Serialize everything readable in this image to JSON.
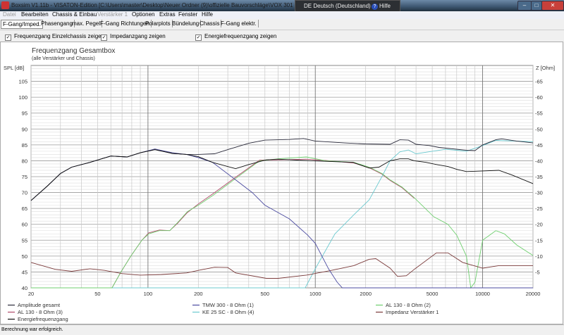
{
  "window": {
    "title": "Boxsim V1.11b - VISATON-Edition [C:\\Users\\master\\Desktop\\Neuer Ordner (9)\\offizielle Bauvorschläge\\VOX 301\\VOX 301",
    "language": "DE Deutsch (Deutschland)",
    "help": "Hilfe",
    "minimize": "–",
    "maximize": "□",
    "close": "✕"
  },
  "menu": [
    "Datei",
    "Bearbeiten",
    "Chassis & Einbau",
    "Verstärker 1",
    "Optionen",
    "Extras",
    "Fenster",
    "Hilfe"
  ],
  "tabs": [
    "F-Gang/Imped.",
    "Phasengang",
    "max. Pegel",
    "F-Gang Richtungen",
    "Polarplots",
    "Bündelung",
    "Chassis",
    "F-Gang elektr."
  ],
  "checkboxes": [
    {
      "label": "Frequenzgang Einzelchassis zeigen",
      "checked": true
    },
    {
      "label": "Impedanzgang zeigen",
      "checked": true
    },
    {
      "label": "Energiefrequenzgang zeigen",
      "checked": true
    }
  ],
  "checkmark": "✓",
  "status": "Berechnung war erfolgreich.",
  "chart_data": {
    "type": "line",
    "title": "Frequenzgang Gesamtbox",
    "subtitle": "(alle Verstärker und Chassis)",
    "ylabel": "SPL [dB]",
    "y2label": "Z [Ohm]",
    "xscale": "log",
    "xlim": [
      20,
      20000
    ],
    "ylim": [
      40,
      110
    ],
    "y2lim": [
      0,
      70
    ],
    "xticks": [
      "20",
      "50",
      "100",
      "200",
      "500",
      "1000",
      "2000",
      "5000",
      "10000",
      "20000"
    ],
    "yticks": [
      "40",
      "45",
      "50",
      "55",
      "60",
      "65",
      "70",
      "75",
      "80",
      "85",
      "90",
      "95",
      "100",
      "105"
    ],
    "y2ticks": [
      "5",
      "10",
      "15",
      "20",
      "25",
      "30",
      "35",
      "40",
      "45",
      "50",
      "55",
      "60",
      "65"
    ],
    "grid": true,
    "legend_position": "bottom",
    "series": [
      {
        "name": "Amplitude gesamt",
        "color": "#2a2a3a",
        "points": [
          [
            20,
            67.5
          ],
          [
            25,
            72
          ],
          [
            30,
            76
          ],
          [
            35,
            78
          ],
          [
            45,
            79.5
          ],
          [
            60,
            81.5
          ],
          [
            75,
            81.2
          ],
          [
            90,
            82.5
          ],
          [
            110,
            83.5
          ],
          [
            140,
            82.3
          ],
          [
            170,
            82
          ],
          [
            200,
            82
          ],
          [
            250,
            82.2
          ],
          [
            300,
            83.5
          ],
          [
            400,
            85.5
          ],
          [
            500,
            86.5
          ],
          [
            700,
            86.7
          ],
          [
            850,
            87
          ],
          [
            1000,
            86.2
          ],
          [
            1500,
            85.6
          ],
          [
            2000,
            85.3
          ],
          [
            2800,
            85.2
          ],
          [
            3200,
            86.6
          ],
          [
            3600,
            86.5
          ],
          [
            4000,
            85.2
          ],
          [
            4800,
            84.8
          ],
          [
            5500,
            84.2
          ],
          [
            6500,
            83.8
          ],
          [
            8000,
            83.3
          ],
          [
            9000,
            83.2
          ],
          [
            10000,
            85
          ],
          [
            12000,
            86.6
          ],
          [
            13000,
            86.9
          ],
          [
            16000,
            86.2
          ],
          [
            20000,
            85.6
          ]
        ]
      },
      {
        "name": "TMW 300 - 8 Ohm (1)",
        "color": "#4b4ba0",
        "points": [
          [
            20,
            67.5
          ],
          [
            25,
            72
          ],
          [
            30,
            76
          ],
          [
            35,
            78
          ],
          [
            45,
            79.5
          ],
          [
            60,
            81.5
          ],
          [
            75,
            81.2
          ],
          [
            90,
            82.5
          ],
          [
            110,
            83.7
          ],
          [
            140,
            82.5
          ],
          [
            170,
            82
          ],
          [
            200,
            81
          ],
          [
            243,
            79.5
          ],
          [
            334,
            74
          ],
          [
            420,
            70
          ],
          [
            500,
            66
          ],
          [
            700,
            61.7
          ],
          [
            900,
            56.6
          ],
          [
            1000,
            54
          ],
          [
            1200,
            46
          ],
          [
            1350,
            41.8
          ],
          [
            1450,
            40
          ],
          [
            20000,
            40
          ]
        ]
      },
      {
        "name": "AL 130 - 8 Ohm (2)",
        "color": "#6fcf6f",
        "points": [
          [
            20,
            40
          ],
          [
            61,
            40
          ],
          [
            69,
            45
          ],
          [
            79,
            50
          ],
          [
            92,
            55
          ],
          [
            101,
            57
          ],
          [
            117,
            58
          ],
          [
            135,
            58
          ],
          [
            150,
            60.5
          ],
          [
            172,
            64
          ],
          [
            200,
            66
          ],
          [
            243,
            69
          ],
          [
            334,
            74.4
          ],
          [
            465,
            80
          ],
          [
            600,
            80.6
          ],
          [
            885,
            81.2
          ],
          [
            1150,
            80
          ],
          [
            1700,
            79.5
          ],
          [
            2100,
            78
          ],
          [
            2500,
            76
          ],
          [
            2800,
            74
          ],
          [
            3300,
            71.7
          ],
          [
            3900,
            68.4
          ],
          [
            5100,
            62.4
          ],
          [
            6200,
            60
          ],
          [
            7000,
            56.6
          ],
          [
            8000,
            50
          ],
          [
            8500,
            40
          ],
          [
            9000,
            41.8
          ],
          [
            10000,
            55
          ],
          [
            12000,
            58
          ],
          [
            13500,
            57
          ],
          [
            16000,
            53.5
          ],
          [
            20000,
            50.2
          ]
        ]
      },
      {
        "name": "AL 130 - 8 Ohm (3)",
        "color": "#b04a6a",
        "points": [
          [
            20,
            40
          ],
          [
            61,
            40
          ],
          [
            69,
            45
          ],
          [
            79,
            50
          ],
          [
            92,
            55
          ],
          [
            101,
            57.3
          ],
          [
            117,
            58.2
          ],
          [
            135,
            58
          ],
          [
            150,
            60.3
          ],
          [
            172,
            63.7
          ],
          [
            200,
            66.4
          ],
          [
            243,
            69.5
          ],
          [
            334,
            74.8
          ],
          [
            465,
            80.2
          ],
          [
            600,
            80.3
          ],
          [
            885,
            80.5
          ],
          [
            1150,
            80.1
          ],
          [
            1700,
            79.3
          ],
          [
            2100,
            77.8
          ],
          [
            2500,
            75.8
          ],
          [
            2800,
            73.8
          ],
          [
            3300,
            71.5
          ],
          [
            3900,
            68.2
          ]
        ]
      },
      {
        "name": "KE 25 SC - 8 Ohm    (4)",
        "color": "#6cc9cf",
        "points": [
          [
            20,
            40
          ],
          [
            870,
            40
          ],
          [
            1000,
            46
          ],
          [
            1310,
            57
          ],
          [
            1700,
            63
          ],
          [
            2100,
            67.7
          ],
          [
            2500,
            75
          ],
          [
            2800,
            80
          ],
          [
            3200,
            82.8
          ],
          [
            3600,
            83.4
          ],
          [
            4000,
            82.2
          ],
          [
            5000,
            83
          ],
          [
            6000,
            83.6
          ],
          [
            7000,
            83.3
          ],
          [
            8000,
            83
          ],
          [
            10000,
            84.8
          ],
          [
            12000,
            86.4
          ],
          [
            16000,
            86.2
          ],
          [
            20000,
            86
          ]
        ]
      },
      {
        "name": "Impedanz Verstärker 1",
        "color": "#7a3a3a",
        "points": [
          [
            20,
            48
          ],
          [
            28,
            45.8
          ],
          [
            35,
            45.2
          ],
          [
            45,
            46
          ],
          [
            55,
            45.5
          ],
          [
            70,
            44.5
          ],
          [
            90,
            44
          ],
          [
            120,
            44.2
          ],
          [
            170,
            44.7
          ],
          [
            200,
            45.5
          ],
          [
            250,
            46.5
          ],
          [
            300,
            46.4
          ],
          [
            334,
            44.7
          ],
          [
            510,
            43
          ],
          [
            600,
            43
          ],
          [
            885,
            44
          ],
          [
            1250,
            45.5
          ],
          [
            1700,
            47
          ],
          [
            2100,
            49
          ],
          [
            2300,
            49.2
          ],
          [
            2800,
            46.2
          ],
          [
            3100,
            43.6
          ],
          [
            3500,
            43.8
          ],
          [
            3900,
            45.8
          ],
          [
            5300,
            51
          ],
          [
            6200,
            51
          ],
          [
            7600,
            48
          ],
          [
            10000,
            46.2
          ],
          [
            12500,
            47
          ],
          [
            20000,
            47
          ]
        ]
      },
      {
        "name": "Energiefrequenzgang",
        "color": "#111111",
        "points": [
          [
            20,
            67.5
          ],
          [
            25,
            72
          ],
          [
            30,
            76
          ],
          [
            35,
            78
          ],
          [
            45,
            79.5
          ],
          [
            60,
            81.5
          ],
          [
            75,
            81.2
          ],
          [
            90,
            82.5
          ],
          [
            110,
            83.5
          ],
          [
            140,
            82.3
          ],
          [
            170,
            82
          ],
          [
            200,
            81.3
          ],
          [
            243,
            79.5
          ],
          [
            334,
            77.5
          ],
          [
            400,
            78.8
          ],
          [
            510,
            80.3
          ],
          [
            600,
            80.5
          ],
          [
            945,
            80
          ],
          [
            1680,
            79.5
          ],
          [
            2100,
            77.7
          ],
          [
            2400,
            78
          ],
          [
            2800,
            80
          ],
          [
            3200,
            80.6
          ],
          [
            3600,
            80.6
          ],
          [
            3900,
            80
          ],
          [
            4600,
            79.5
          ],
          [
            5300,
            78.8
          ],
          [
            6200,
            78.2
          ],
          [
            7000,
            77.3
          ],
          [
            8000,
            76.6
          ],
          [
            10000,
            76.8
          ],
          [
            12500,
            77
          ],
          [
            15000,
            75.5
          ],
          [
            20000,
            72.8
          ]
        ]
      }
    ]
  }
}
